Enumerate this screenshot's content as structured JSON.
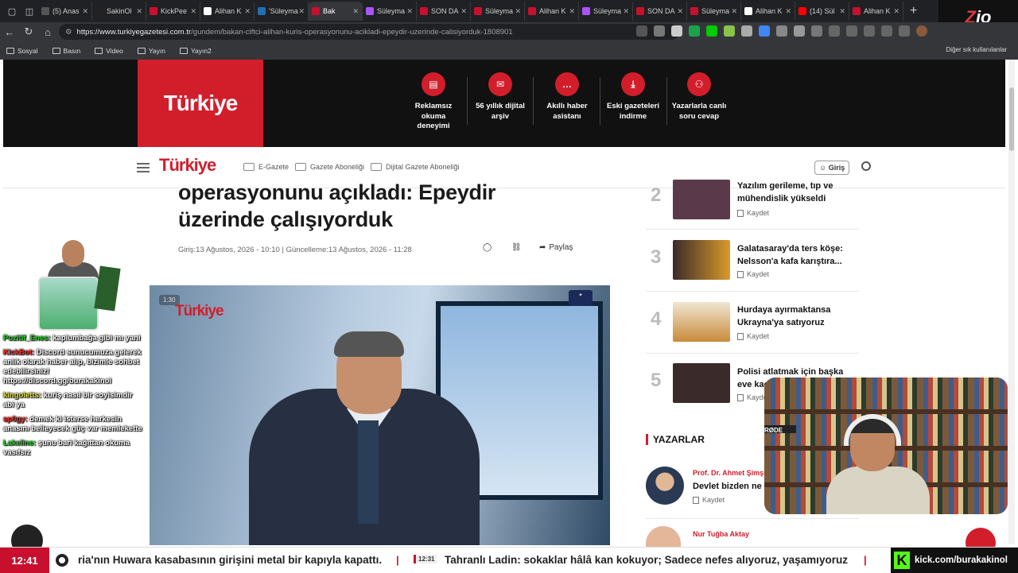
{
  "browser": {
    "tabs": [
      {
        "label": "(5) Anas",
        "color": "#555"
      },
      {
        "label": "SakinOl",
        "color": "#222"
      },
      {
        "label": "KickPee",
        "color": "#c8102e"
      },
      {
        "label": "Alihan K",
        "color": "#fff"
      },
      {
        "label": "'Süleyma",
        "color": "#1f6fb2"
      },
      {
        "label": "Bak",
        "color": "#c8102e"
      },
      {
        "label": "Süleyma",
        "color": "#a855f7"
      },
      {
        "label": "SON DA",
        "color": "#c8102e"
      },
      {
        "label": "Süleyma",
        "color": "#c8102e"
      },
      {
        "label": "Alihan K",
        "color": "#c8102e"
      },
      {
        "label": "Süleyma",
        "color": "#a855f7"
      },
      {
        "label": "SON DA",
        "color": "#c8102e"
      },
      {
        "label": "Süleyma",
        "color": "#c8102e"
      },
      {
        "label": "Alihan K",
        "color": "#fff"
      },
      {
        "label": "(14) Sül",
        "color": "#ff0000"
      },
      {
        "label": "Alihan K",
        "color": "#c8102e"
      }
    ],
    "url_host": "https://www.turkiyegazetesi.com.tr",
    "url_path": "/gundem/bakan-ciftci-alihan-kuris-operasyonunu-acikladi-epeydir-uzerinde-calisiyorduk-1808901",
    "bookmarks": [
      "Sosyal",
      "Basın",
      "Video",
      "Yayın",
      "Yayın2"
    ],
    "bookmarks_right": "Diğer sık kullanılanlar"
  },
  "overlay_logo": "Z",
  "site": {
    "brand": "Türkiye",
    "features": [
      {
        "label": "Reklamsız okuma deneyimi"
      },
      {
        "label": "56 yıllık dijital arşiv"
      },
      {
        "label": "Akıllı haber asistanı"
      },
      {
        "label": "Eski gazeteleri indirme"
      },
      {
        "label": "Yazarlarla canlı soru cevap"
      }
    ],
    "nav": {
      "logo": "Türkiye",
      "links": [
        "E-Gazete",
        "Gazete Aboneliği",
        "Dijital Gazete Aboneliği"
      ],
      "login": "Giriş"
    }
  },
  "article": {
    "headline_1": "operasyonunu açıkladı: Epeydir",
    "headline_2": "üzerinde çalışıyorduk",
    "published": "Giriş:13 Ağustos, 2026 - 10:10",
    "updated": "Güncelleme:13 Ağustos, 2026 - 11:28",
    "share_label": "Paylaş",
    "video_time": "1:30",
    "video_logo": "Türkiye"
  },
  "chat": [
    {
      "user": "Pozitif_Enes:",
      "text": "kaplumbağa gibi mı yani",
      "color": "#2bd32b"
    },
    {
      "user": "KickBot:",
      "text": "Discord sunucumuza gelerek anlık olarak haber alıp, bizimle sohbet edebilirsiniz! https://discord.gg/burakakinol",
      "color": "#ff3030"
    },
    {
      "user": "kingoletts:",
      "text": "kuriş nasıl bir soyisimdir abi ya",
      "color": "#e0e040"
    },
    {
      "user": "sp0gy:",
      "text": "demek ki isterse herkesin anasını belleyecek güç var memlekette",
      "color": "#ff3030"
    },
    {
      "user": "Lakeline:",
      "text": "şunu bari kağıttan okuma vasıfsız",
      "color": "#2bd32b"
    }
  ],
  "sidebar": {
    "items": [
      {
        "rank": "2",
        "title": "Yazılım gerileme, tıp ve mühendislik yükseldi",
        "save": "Kaydet",
        "thumb": "#5a3a4a"
      },
      {
        "rank": "3",
        "title": "Galatasaray'da ters köşe: Nelsson'a kafa karıştıra...",
        "save": "Kaydet",
        "thumb": "#d99a2a"
      },
      {
        "rank": "4",
        "title": "Hurdaya ayırmaktansa Ukrayna'ya satıyoruz",
        "save": "Kaydet",
        "thumb": "#e6c089"
      },
      {
        "rank": "5",
        "title": "Polisi atlatmak için başka eve kaçtı, giz...",
        "save": "Kaydet",
        "thumb": "#3a2a2a"
      }
    ],
    "authors_heading": "YAZARLAR",
    "authors": [
      {
        "name": "Prof. Dr. Ahmet Şimşir",
        "title": "Devlet bizden ne i...",
        "save": "Kaydet"
      },
      {
        "name": "Nur Tuğba Aktay",
        "title": "",
        "save": ""
      }
    ]
  },
  "webcam_label": "RØDE",
  "ticker": {
    "time": "12:41",
    "text_1": "ria'nın Huwara kasabasının girişini metal bir kapıyla kapattı.",
    "badge": "12:31",
    "text_2": "Tahranlı Ladin: sokaklar hâlâ kan kokuyor; Sadece nefes alıyoruz, yaşamıyoruz",
    "kick_url": "kick.com/burakakinol"
  }
}
